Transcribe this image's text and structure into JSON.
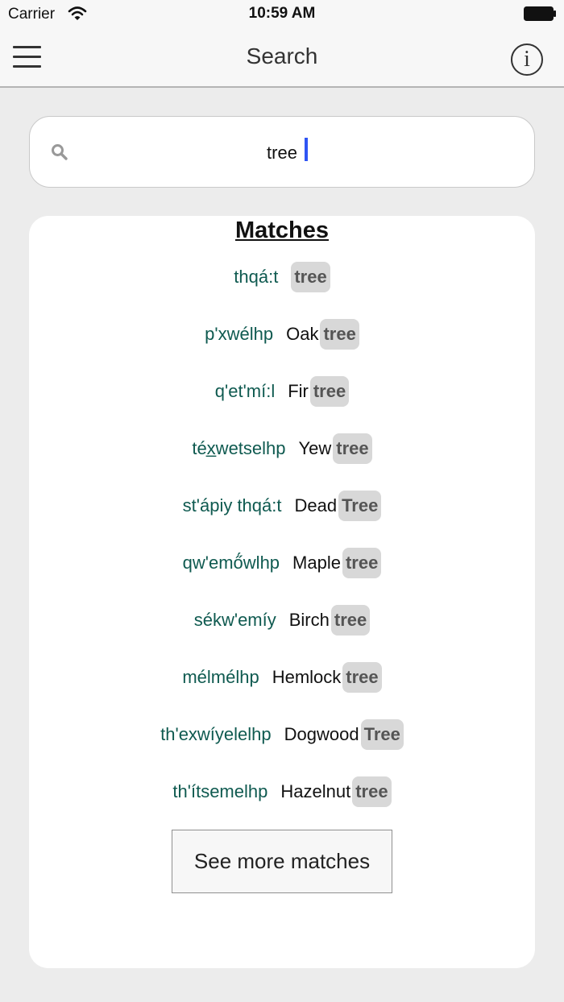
{
  "status_bar": {
    "carrier": "Carrier",
    "time": "10:59 AM"
  },
  "nav": {
    "title": "Search",
    "menu_icon": "hamburger-menu-icon",
    "info_icon": "info-icon",
    "info_glyph": "i"
  },
  "search": {
    "value": "tree",
    "icon": "search-icon",
    "cursor_color": "#2f55f4"
  },
  "results": {
    "title": "Matches",
    "items": [
      {
        "word": "thqá:t",
        "prefix": "",
        "match": "tree"
      },
      {
        "word": "p'xwélhp",
        "prefix": "Oak",
        "match": "tree"
      },
      {
        "word": "q'et'mí:l",
        "prefix": "Fir",
        "match": "tree"
      },
      {
        "word": "téx̲wetselhp",
        "prefix": "Yew",
        "match": "tree"
      },
      {
        "word": "st'ápiy thqá:t",
        "prefix": "Dead",
        "match": "Tree"
      },
      {
        "word": "qw'emő́wlhp",
        "prefix": "Maple",
        "match": "tree"
      },
      {
        "word": "sékw'emíy",
        "prefix": "Birch",
        "match": "tree"
      },
      {
        "word": "mélmélhp",
        "prefix": "Hemlock",
        "match": "tree"
      },
      {
        "word": "th'exwíyelelhp",
        "prefix": "Dogwood",
        "match": "Tree"
      },
      {
        "word": "th'ítsemelhp",
        "prefix": "Hazelnut",
        "match": "tree"
      }
    ],
    "more_label": "See more matches"
  },
  "colors": {
    "word": "#0f5a50",
    "highlight_bg": "#d8d8d8",
    "highlight_text": "#555555",
    "background": "#ececec"
  }
}
